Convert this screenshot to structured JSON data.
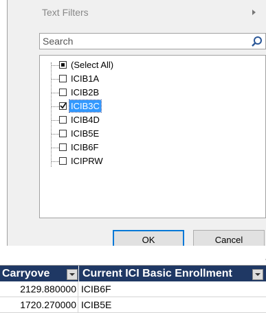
{
  "menu": {
    "text_filters_label": "Text Filters"
  },
  "search": {
    "placeholder": "Search"
  },
  "filter_list": {
    "items": [
      {
        "label": "(Select All)",
        "state": "partial"
      },
      {
        "label": "ICIB1A",
        "state": "unchecked"
      },
      {
        "label": "ICIB2B",
        "state": "unchecked"
      },
      {
        "label": "ICIB3C",
        "state": "checked"
      },
      {
        "label": "ICIB4D",
        "state": "unchecked"
      },
      {
        "label": "ICIB5E",
        "state": "unchecked"
      },
      {
        "label": "ICIB6F",
        "state": "unchecked"
      },
      {
        "label": "ICIPRW",
        "state": "unchecked"
      }
    ]
  },
  "buttons": {
    "ok_label": "OK",
    "cancel_label": "Cancel"
  },
  "sheet": {
    "headers": [
      "Carryove",
      "Current ICI Basic Enrollment"
    ],
    "rows": [
      [
        "2129.880000",
        "ICIB6F"
      ],
      [
        "1720.270000",
        "ICIB5E"
      ]
    ]
  },
  "colors": {
    "header_bg": "#1f3864",
    "selection": "#3399ff"
  }
}
